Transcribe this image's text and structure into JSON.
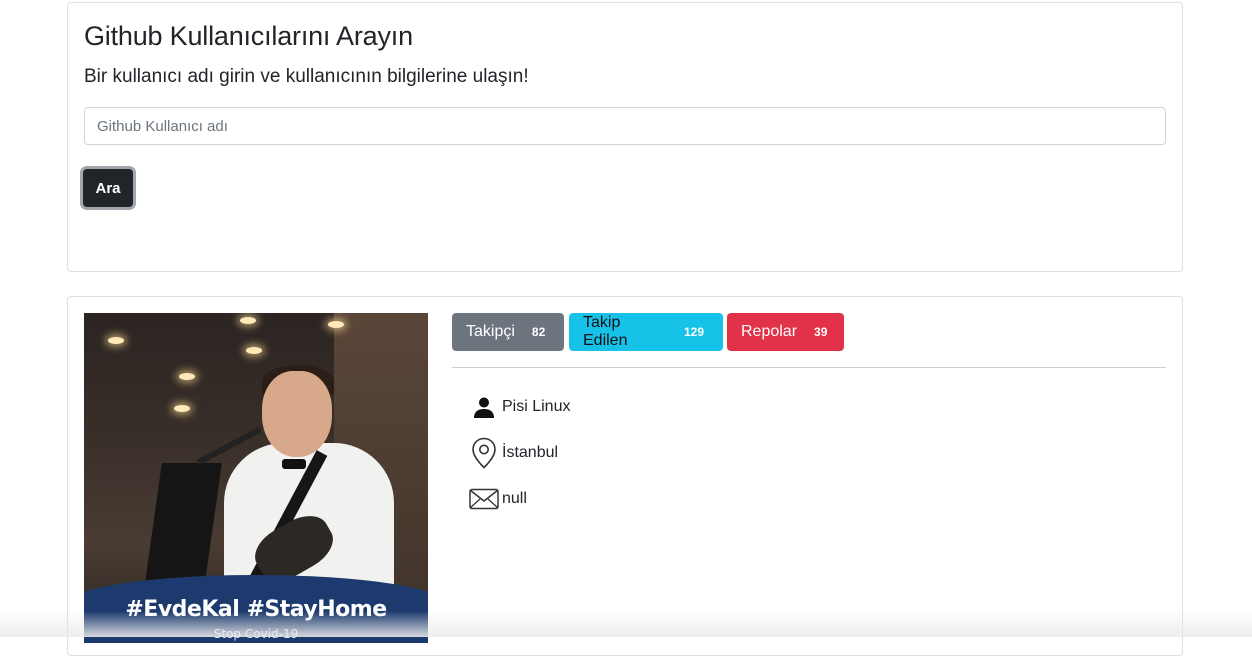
{
  "search": {
    "title": "Github Kullanıcılarını Arayın",
    "subtitle": "Bir kullanıcı adı girin ve kullanıcının bilgilerine ulaşın!",
    "placeholder": "Github Kullanıcı adı",
    "value": "",
    "button_label": "Ara"
  },
  "profile": {
    "avatar_caption": "#EvdeKal #StayHome",
    "avatar_subcaption": "Stop Covid-19",
    "stats": [
      {
        "label": "Takipçi",
        "count": "82",
        "color": "#6c757d"
      },
      {
        "label": "Takip Edilen",
        "count": "129",
        "color": "#17c2e8"
      },
      {
        "label": "Repolar",
        "count": "39",
        "color": "#e2324a"
      }
    ],
    "info": {
      "name": "Pisi Linux",
      "location": "İstanbul",
      "email": "null"
    },
    "icons": {
      "name": "person-icon",
      "location": "location-pin-icon",
      "email": "envelope-icon"
    }
  }
}
